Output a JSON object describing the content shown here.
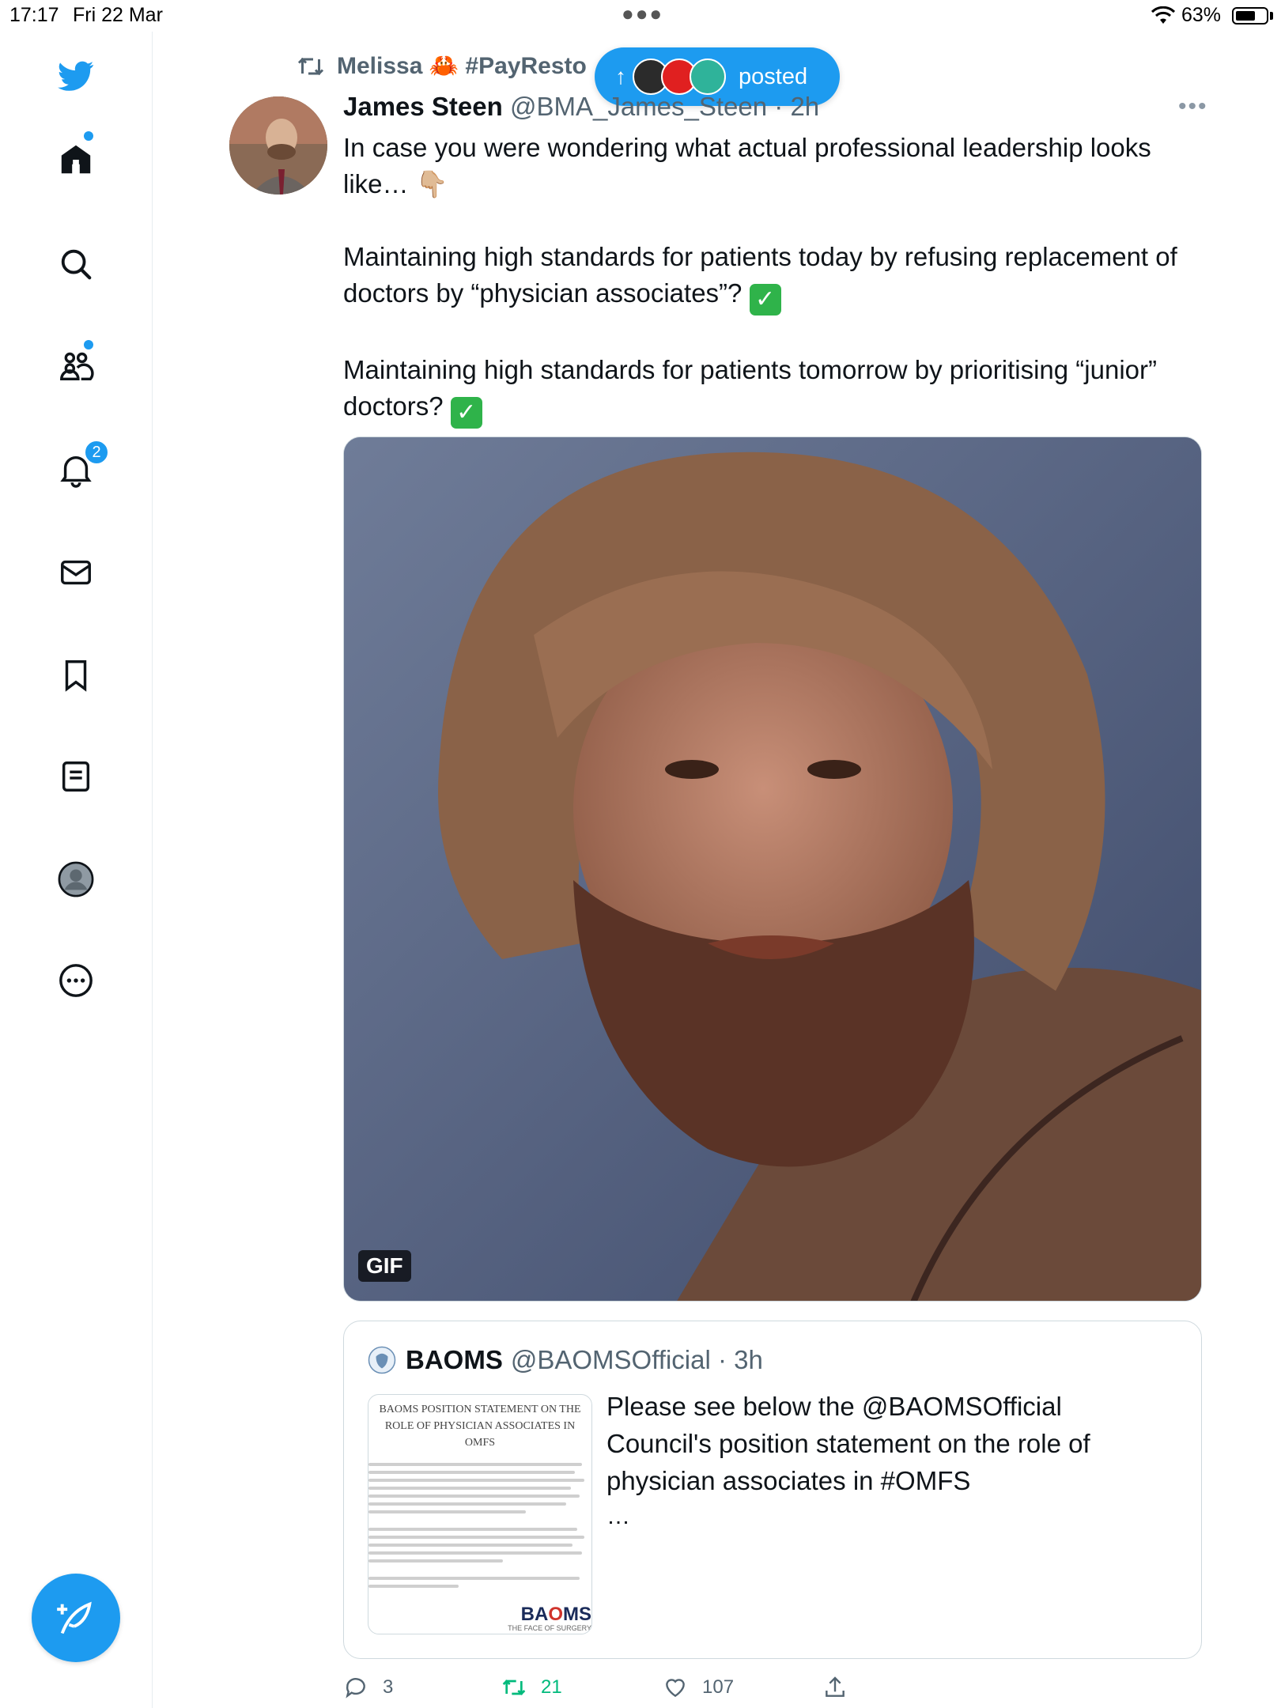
{
  "status_bar": {
    "time": "17:17",
    "date": "Fri 22 Mar",
    "battery": "63%",
    "battery_level": 0.63
  },
  "sidebar": {
    "items": [
      {
        "icon": "twitter-logo-icon"
      },
      {
        "icon": "home-icon",
        "has_dot": true
      },
      {
        "icon": "search-icon"
      },
      {
        "icon": "communities-icon",
        "has_dot": true
      },
      {
        "icon": "bell-icon",
        "badge": "2"
      },
      {
        "icon": "mail-icon"
      },
      {
        "icon": "bookmark-icon"
      },
      {
        "icon": "lists-icon"
      },
      {
        "icon": "profile-icon"
      },
      {
        "icon": "more-icon"
      }
    ],
    "compose_icon": "compose-tweet-icon"
  },
  "colors": {
    "accent": "#1d9bf0",
    "retweet_green": "#00ba7c",
    "secondary_text": "#536471"
  },
  "retweet": {
    "icon": "retweet-icon",
    "label": "Melissa 🦀 #PayResto"
  },
  "new_posts_pill": {
    "label": "posted",
    "arrow": "↑"
  },
  "tweet": {
    "author_name": "James Steen",
    "author_handle": "@BMA_James_Steen · 2h",
    "more": "•••",
    "paragraphs": [
      "In case you were wondering what actual professional leadership looks like… 👇🏼",
      "Maintaining high standards for patients today by refusing replacement of doctors by “physician associates”?",
      "Maintaining high standards for patients tomorrow by prioritising “junior” doctors?"
    ],
    "check": "✓",
    "media_badge": "GIF"
  },
  "quote": {
    "author_name": "BAOMS",
    "author_handle": "@BAOMSOfficial · 3h",
    "doc_title": "BAOMS POSITION STATEMENT ON THE ROLE OF PHYSICIAN ASSOCIATES IN OMFS",
    "doc_logo_a": "BA",
    "doc_logo_o": "O",
    "doc_logo_b": "MS",
    "doc_tagline": "THE FACE OF SURGERY",
    "text": "Please see below the @BAOMSOfficial Council's position statement on the role of physician associates in #OMFS",
    "ellipsis": "…"
  },
  "actions": {
    "replies": "3",
    "retweets": "21",
    "likes": "107"
  }
}
